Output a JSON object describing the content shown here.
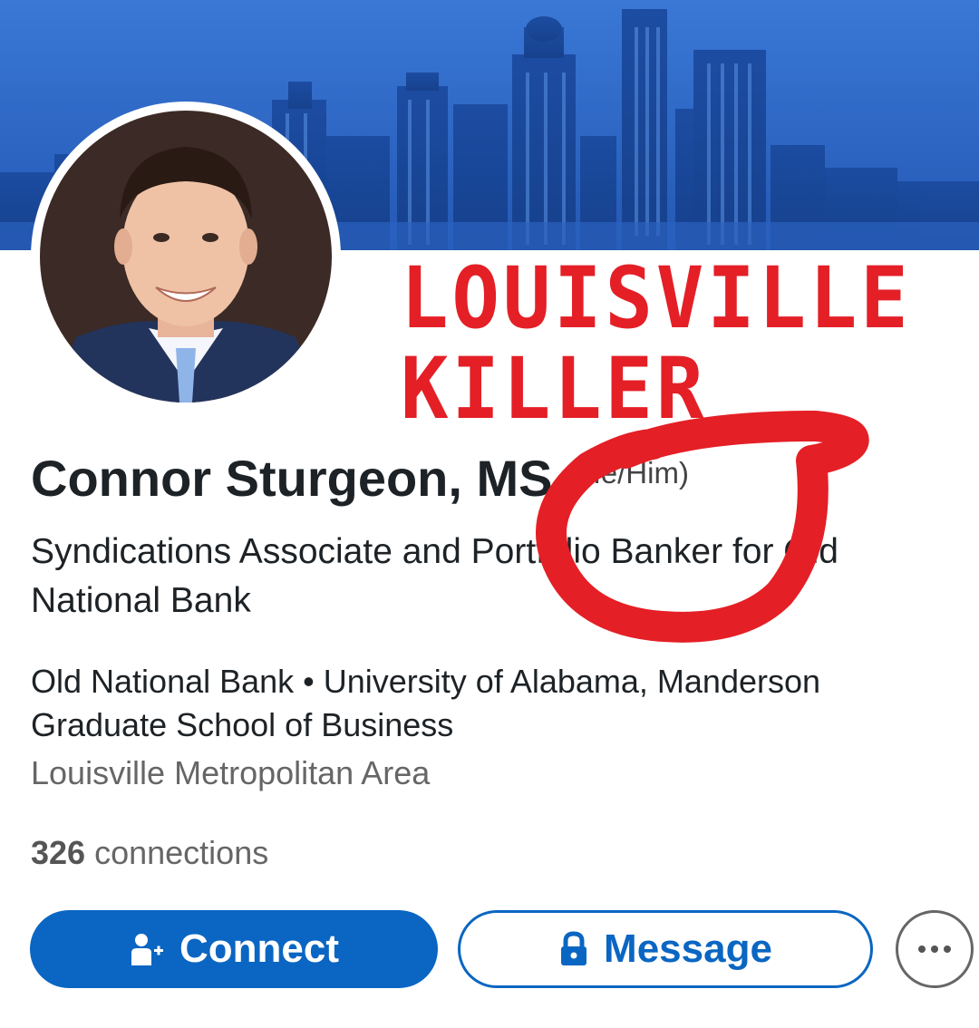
{
  "banner": {
    "bg_color": "#2a5fbd",
    "image": "city-skyline"
  },
  "profile": {
    "avatar": "profile-photo",
    "name": "Connor Sturgeon, MS",
    "pronouns": "(He/Him)",
    "headline": "Syndications Associate and Portfolio Banker for Old National Bank",
    "affiliation": "Old National Bank • University of Alabama, Manderson Graduate School of Business",
    "location": "Louisville Metropolitan Area",
    "connections_count": "326",
    "connections_label": "connections"
  },
  "overlay": {
    "line1": "LOUISVILLE",
    "line2": "KILLER",
    "color": "#e41f26"
  },
  "actions": {
    "connect_label": "Connect",
    "connect_icon": "add-person-icon",
    "message_label": "Message",
    "message_icon": "lock-icon",
    "more_icon": "more-horizontal-icon",
    "accent_color": "#0a66c2"
  }
}
